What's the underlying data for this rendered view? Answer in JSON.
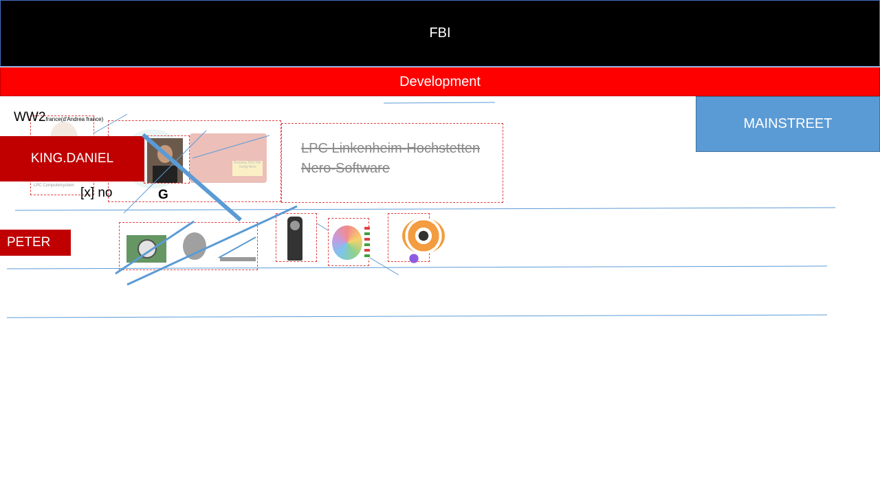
{
  "header": {
    "title": "FBI"
  },
  "subheader": {
    "title": "Development"
  },
  "buttons": {
    "mainstreet": "MAINSTREET",
    "king_daniel": "KING.DANIEL",
    "peter": "PETER"
  },
  "labels": {
    "ww2": "WW2",
    "ww2_note": "france(d'Andrea france)",
    "checkbox_no": "[x] no",
    "g": "G",
    "thumb_caption": "LPC Computersystem",
    "poster_text": "Running TKO File Using Nero"
  },
  "struck_lines": [
    "LPC Linkenheim-Hochstetten",
    "Nero-Software"
  ],
  "colors": {
    "header_bg": "#000000",
    "dev_bg": "#ff0000",
    "accent_red": "#c00000",
    "accent_blue": "#5b9bd5"
  }
}
